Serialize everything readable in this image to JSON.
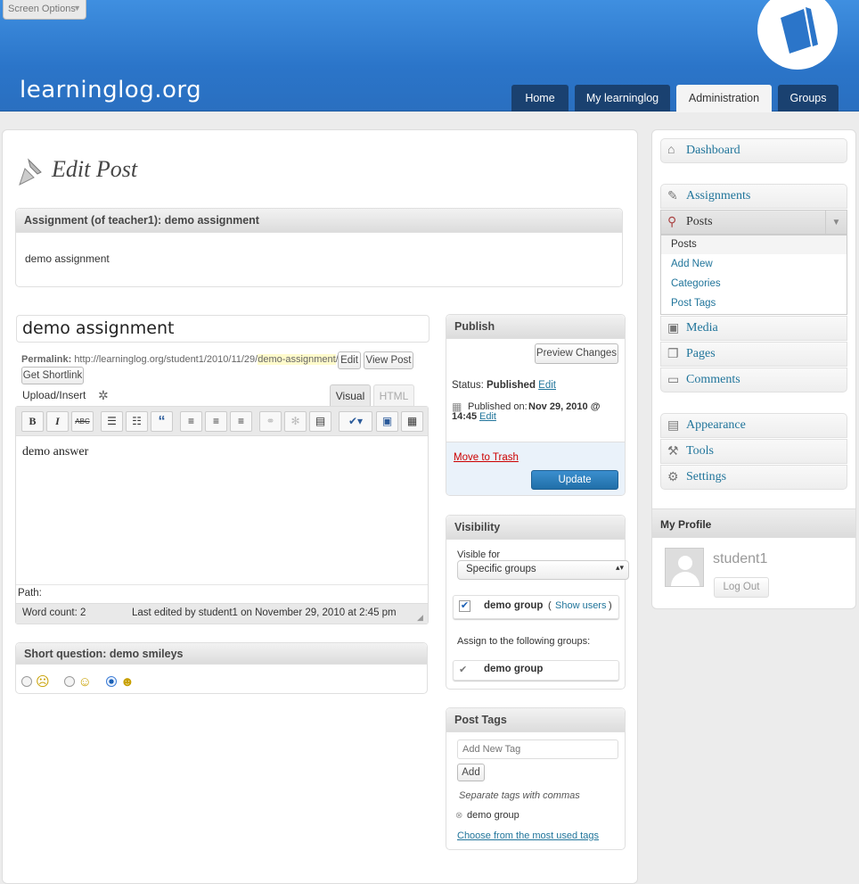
{
  "screen_options": "Screen Options",
  "logo_text": "learninglog.org",
  "nav": [
    "Home",
    "My learninglog",
    "Administration",
    "Groups"
  ],
  "page_title": "Edit Post",
  "assignment": {
    "header": "Assignment (of teacher1): demo assignment",
    "body": "demo assignment"
  },
  "post": {
    "title": "demo assignment",
    "permalink_label": "Permalink:",
    "permalink_base": "http://learninglog.org/student1/2010/11/29/",
    "permalink_slug": "demo-assignment",
    "permalink_end": "/",
    "edit_btn": "Edit",
    "view_btn": "View Post",
    "shortlink_btn": "Get Shortlink",
    "upload_label": "Upload/Insert",
    "tab_visual": "Visual",
    "tab_html": "HTML",
    "content": "demo answer",
    "path_label": "Path:",
    "word_count": "Word count: 2",
    "last_edited": "Last edited by student1 on November 29, 2010 at 2:45 pm"
  },
  "toolbar": {
    "bold": "B",
    "italic": "I",
    "strike": "ABC",
    "quote": "“"
  },
  "short_question": {
    "header": "Short question: demo smileys",
    "selected": 3
  },
  "publish": {
    "header": "Publish",
    "preview": "Preview Changes",
    "status_label": "Status:",
    "status_value": "Published",
    "status_edit": "Edit",
    "published_label": "Published on:",
    "published_date": "Nov 29, 2010 @",
    "published_time": "14:45",
    "published_edit": "Edit",
    "trash": "Move to Trash",
    "update": "Update"
  },
  "visibility": {
    "header": "Visibility",
    "visible_for": "Visible for",
    "select_value": "Specific groups",
    "group1": "demo group",
    "show_users_open": "(",
    "show_users": "Show users",
    "show_users_close": ")",
    "assign_label": "Assign to the following groups:",
    "group2": "demo group"
  },
  "post_tags": {
    "header": "Post Tags",
    "placeholder": "Add New Tag",
    "add_btn": "Add",
    "hint": "Separate tags with commas",
    "tag": "demo group",
    "most_used": "Choose from the most used tags"
  },
  "sidebar": {
    "dashboard": "Dashboard",
    "assignments": "Assignments",
    "posts": "Posts",
    "posts_sub": [
      "Posts",
      "Add New",
      "Categories",
      "Post Tags"
    ],
    "media": "Media",
    "pages": "Pages",
    "comments": "Comments",
    "appearance": "Appearance",
    "tools": "Tools",
    "settings": "Settings"
  },
  "profile": {
    "header": "My Profile",
    "name": "student1",
    "logout": "Log Out"
  },
  "colors": {
    "header_blue": "#2b75c9",
    "nav_dark": "#1a4170",
    "link": "#21759b",
    "update_btn": "#2a78b0",
    "trash": "#cc0000"
  }
}
